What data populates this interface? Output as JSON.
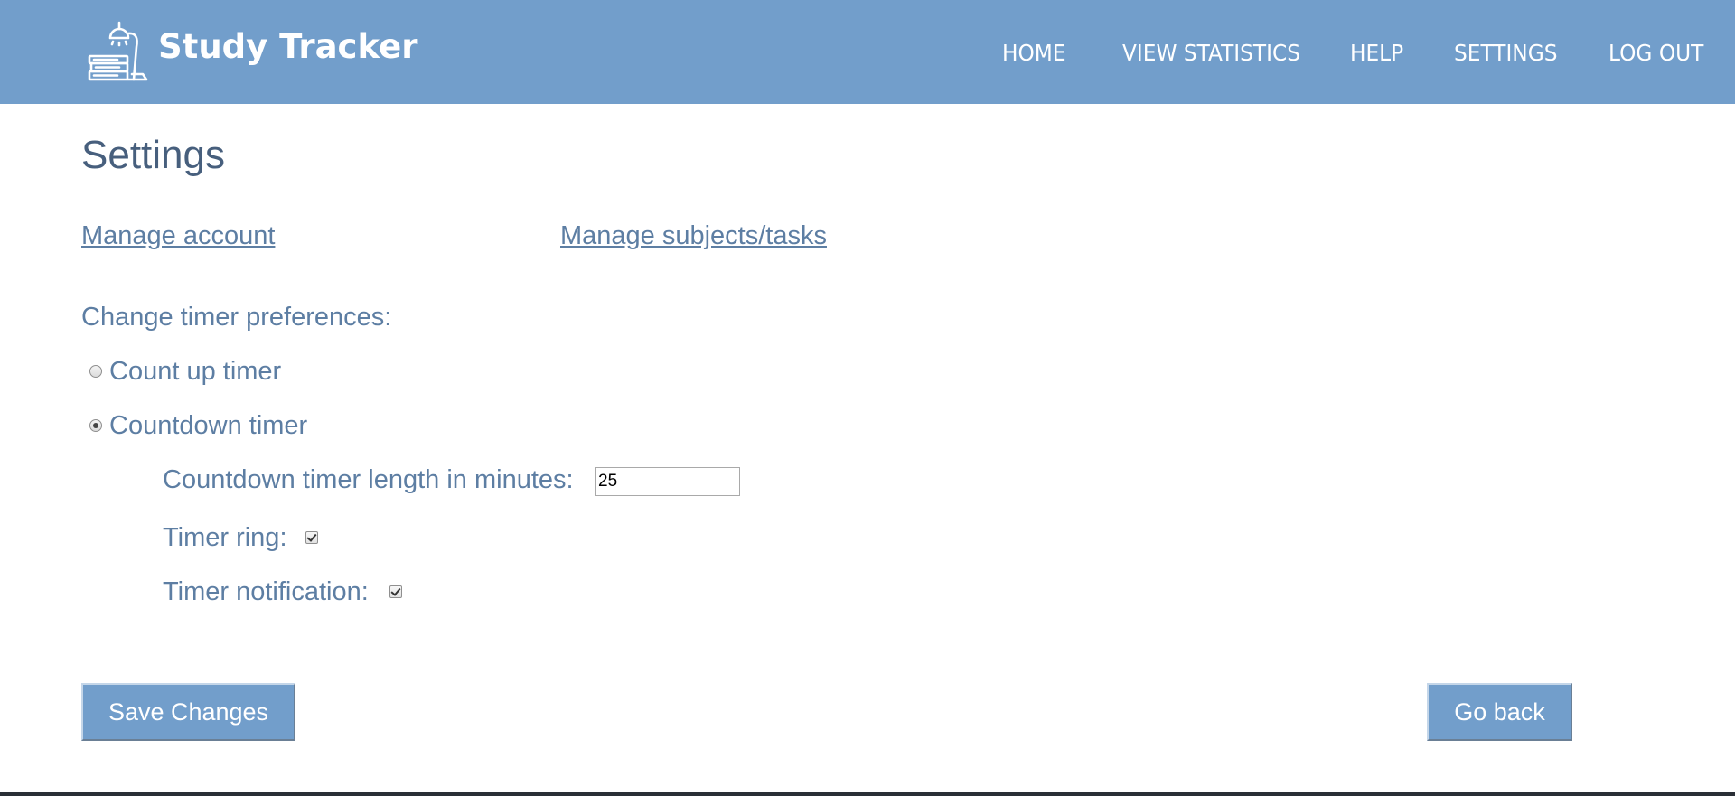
{
  "header": {
    "brand": "Study Tracker",
    "logo_icon": "desk-lamp-books-icon",
    "nav": [
      {
        "label": "HOME"
      },
      {
        "label": "VIEW STATISTICS"
      },
      {
        "label": "HELP"
      },
      {
        "label": "SETTINGS"
      },
      {
        "label": "LOG OUT"
      }
    ]
  },
  "page": {
    "title": "Settings",
    "links": {
      "manage_account": "Manage account",
      "manage_subjects": "Manage subjects/tasks"
    },
    "timer": {
      "heading": "Change timer preferences:",
      "options": [
        {
          "label": "Count up timer",
          "checked": false
        },
        {
          "label": "Countdown timer",
          "checked": true
        }
      ],
      "length_label": "Countdown timer length in minutes:",
      "length_value": "25",
      "ring_label": "Timer ring:",
      "ring_checked": true,
      "notification_label": "Timer notification:",
      "notification_checked": true
    },
    "buttons": {
      "save": "Save Changes",
      "back": "Go back"
    }
  },
  "colors": {
    "header_bg": "#729ecb",
    "heading_text": "#475f7d",
    "body_text": "#5d7ea3",
    "button_bg": "#729ecb"
  }
}
